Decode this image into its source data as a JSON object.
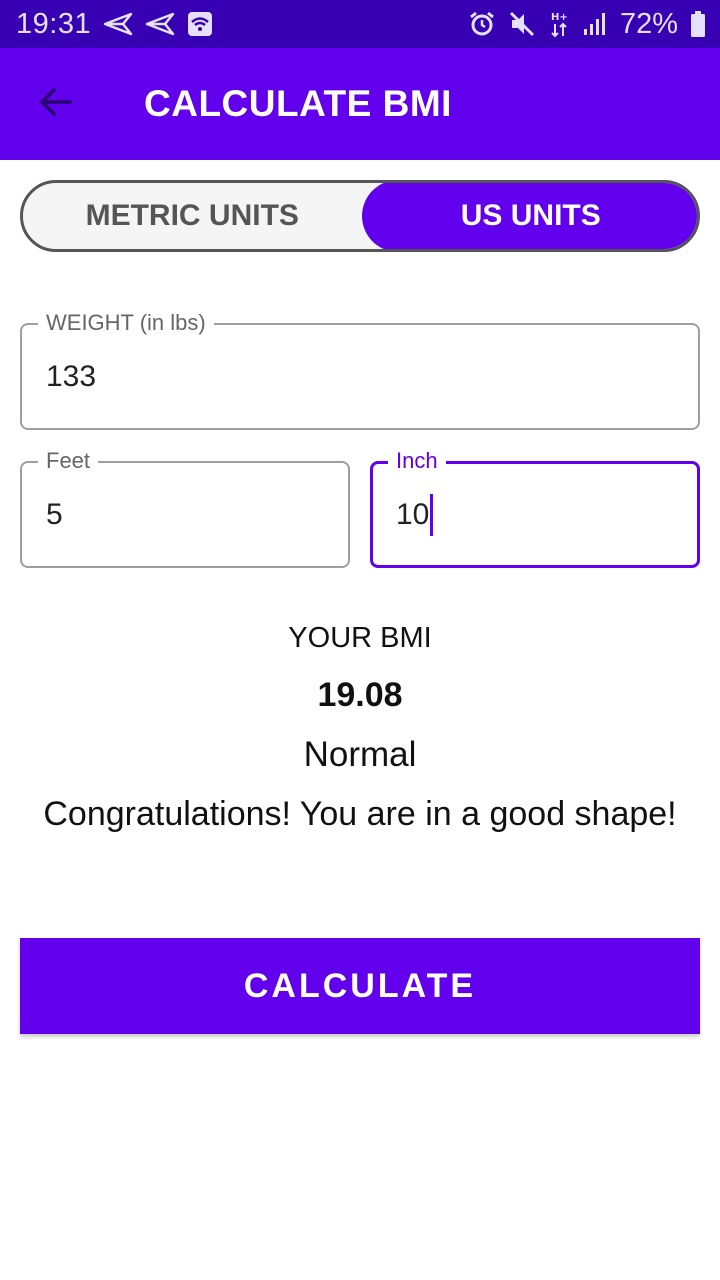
{
  "status_bar": {
    "time": "19:31",
    "battery": "72%",
    "icons_left": [
      "send-icon",
      "send-icon",
      "wifi-notification-icon"
    ],
    "icons_right": [
      "alarm-icon",
      "mute-icon",
      "data-arrows-icon",
      "signal-icon",
      "battery-icon"
    ]
  },
  "app_bar": {
    "title": "CALCULATE BMI",
    "back_icon": "arrow-back-icon"
  },
  "units_toggle": {
    "metric_label": "METRIC UNITS",
    "us_label": "US UNITS",
    "selected": "US UNITS"
  },
  "form": {
    "weight_label": "WEIGHT (in lbs)",
    "weight_value": "133",
    "feet_label": "Feet",
    "feet_value": "5",
    "inch_label": "Inch",
    "inch_value": "10"
  },
  "result": {
    "heading": "YOUR BMI",
    "value": "19.08",
    "category": "Normal",
    "message": "Congratulations! You are in a good shape!"
  },
  "actions": {
    "calculate_label": "CALCULATE"
  },
  "colors": {
    "primary": "#6200ee",
    "primary_dark": "#3700b3"
  }
}
